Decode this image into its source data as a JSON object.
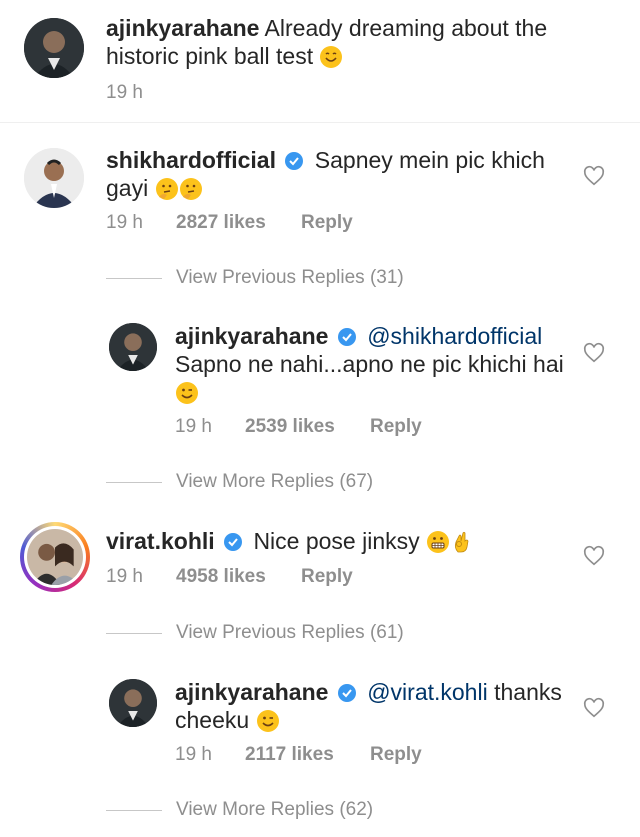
{
  "comments": [
    {
      "username": "ajinkyarahane",
      "text_line1": "Already dreaming about the",
      "text_line2": "historic pink ball test",
      "emoji": "smiling-emoji",
      "time": "19 h"
    },
    {
      "username": "shikhardofficial",
      "text_line1": "Sapney mein pic khich",
      "text_line2": "gayi",
      "emoji": "thinking-emoji",
      "time": "19 h",
      "likes": "2827 likes",
      "reply": "Reply",
      "view_replies": "View Previous Replies (31)"
    },
    {
      "username": "ajinkyarahane",
      "mention": "@shikhardofficial",
      "text_line1": "Sapno ne nahi...apno ne pic khichi hai",
      "emoji": "winking-emoji",
      "time": "19 h",
      "likes": "2539 likes",
      "reply": "Reply",
      "view_replies": "View More Replies (67)"
    },
    {
      "username": "virat.kohli",
      "text_line1": "Nice pose jinksy",
      "emoji": "grimacing-ok-emoji",
      "time": "19 h",
      "likes": "4958 likes",
      "reply": "Reply",
      "view_replies": "View Previous Replies (61)"
    },
    {
      "username": "ajinkyarahane",
      "mention": "@virat.kohli",
      "text_tail": "thanks",
      "text_line2": "cheeku",
      "emoji": "winking-emoji",
      "time": "19 h",
      "likes": "2117 likes",
      "reply": "Reply",
      "view_replies": "View More Replies (62)"
    }
  ],
  "colors": {
    "text": "#262626",
    "muted": "#8e8e8e",
    "mention": "#003569",
    "verified": "#3897f0"
  }
}
